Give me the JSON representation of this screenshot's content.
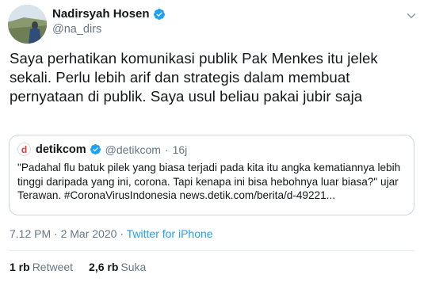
{
  "author": {
    "display_name": "Nadirsyah Hosen",
    "handle": "@na_dirs"
  },
  "tweet": {
    "lines": [
      "Saya perhatikan komunikasi publik Pak Menkes itu jelek",
      "sekali. Perlu lebih arif dan strategis dalam membuat",
      "pernyataan di publik. Saya usul beliau pakai jubir saja"
    ]
  },
  "quoted": {
    "logo_letter": "d",
    "display_name": "detikcom",
    "handle": "@detikcom",
    "separator": "·",
    "time": "16j",
    "lines": [
      "\"Padahal flu batuk pilek yang biasa terjadi pada kita itu angka kematiannya lebih",
      "tinggi daripada yang ini, corona. Tapi kenapa ini bisa hebohnya luar biasa?\" ujar",
      "Terawan. #CoronaVirusIndonesia news.detik.com/berita/d-49221..."
    ]
  },
  "meta": {
    "time": "7.12 PM",
    "separator1": "·",
    "date": "2 Mar 2020",
    "separator2": "·",
    "source": "Twitter for iPhone"
  },
  "stats": {
    "retweets_count": "1 rb",
    "retweets_label": "Retweet",
    "likes_count": "2,6 rb",
    "likes_label": "Suka"
  },
  "colors": {
    "verified": "#1da1f2",
    "link": "#1da1f2",
    "secondary_text": "#657786",
    "border": "#ccd6dd",
    "detik_red": "#e4382d"
  },
  "icons": {
    "verified": "verified-badge-icon",
    "menu": "chevron-down-icon"
  }
}
